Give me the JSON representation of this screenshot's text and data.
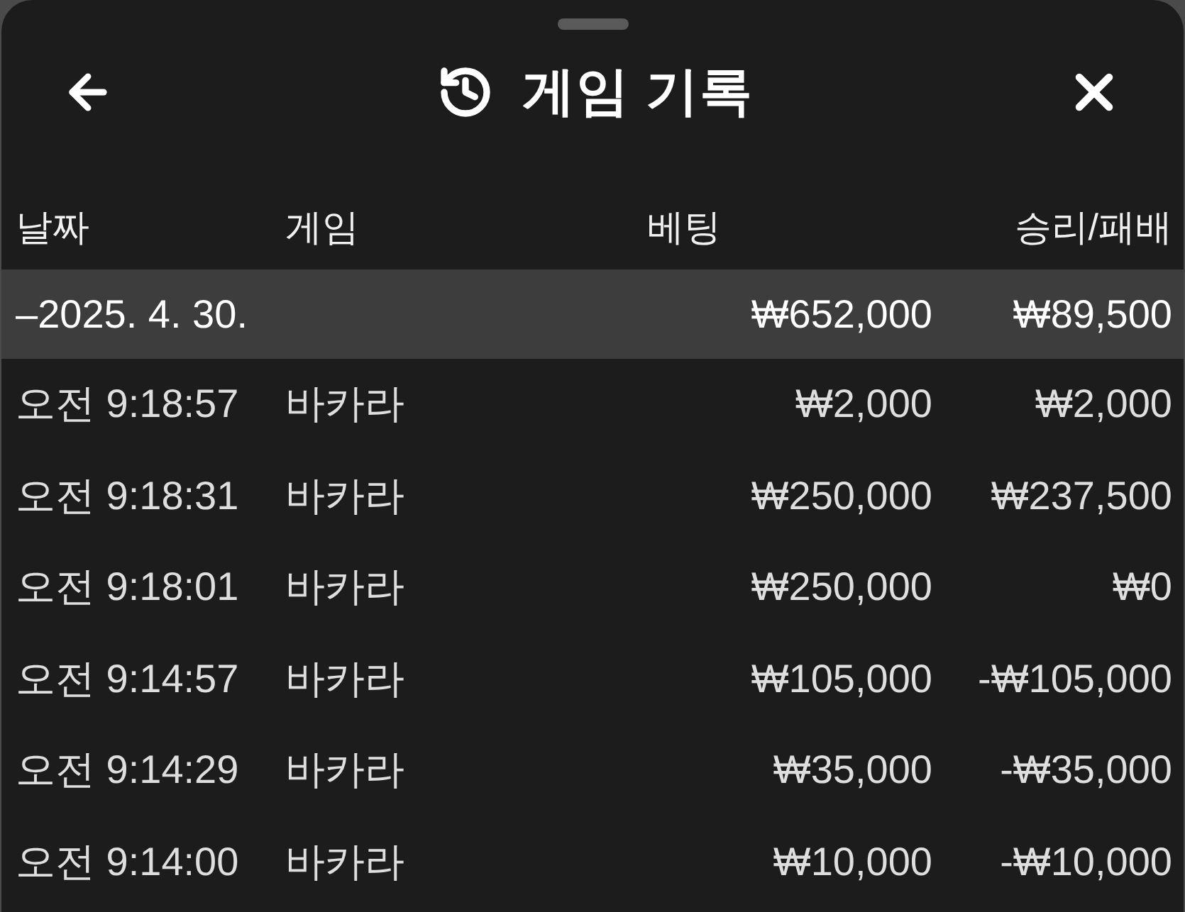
{
  "header": {
    "title": "게임 기록"
  },
  "table": {
    "columns": [
      "날짜",
      "게임",
      "베팅",
      "승리/패배"
    ],
    "groups": [
      {
        "date": "–2025. 4. 30.",
        "bet_total": "₩652,000",
        "result_total": "₩89,500",
        "rows": [
          {
            "time": "오전 9:18:57",
            "game": "바카라",
            "bet": "₩2,000",
            "result": "₩2,000"
          },
          {
            "time": "오전 9:18:31",
            "game": "바카라",
            "bet": "₩250,000",
            "result": "₩237,500"
          },
          {
            "time": "오전 9:18:01",
            "game": "바카라",
            "bet": "₩250,000",
            "result": "₩0"
          },
          {
            "time": "오전 9:14:57",
            "game": "바카라",
            "bet": "₩105,000",
            "result": "-₩105,000"
          },
          {
            "time": "오전 9:14:29",
            "game": "바카라",
            "bet": "₩35,000",
            "result": "-₩35,000"
          },
          {
            "time": "오전 9:14:00",
            "game": "바카라",
            "bet": "₩10,000",
            "result": "-₩10,000"
          }
        ]
      }
    ]
  }
}
